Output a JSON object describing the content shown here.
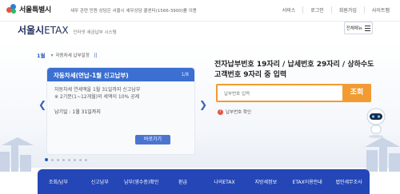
{
  "topbar": {
    "logo_text": "서울특별시",
    "notice": "세무 관련 민원 상담은 서울시 세무상담 콜센터(1566-3900)를 이용",
    "utility_links": [
      "서비스",
      "로그인",
      "회원가입",
      "사이트맵"
    ]
  },
  "header": {
    "brand_seoul": "서울시",
    "brand_etax": "ETAX",
    "brand_sub": "인터넷 세금납부 시스템",
    "menu_label": "전체메뉴"
  },
  "schedule": {
    "month": "1월",
    "category": "자동차세 납부일정",
    "control": "||",
    "card_title": "자동차세(연납-1월 신고납부)",
    "card_page": "1/8",
    "line1": "자동차세 연세액을 1월 31일까지 신고납부",
    "line2": "※ 2기분(1~12개월)의 세액이 10% 공제",
    "due": "납기일 : 1월 31일까지",
    "button_label": "바로가기"
  },
  "search": {
    "title": "전자납부번호 19자리 / 납세번호 29자리 / 상하수도고객번호 9자리 중 입력",
    "placeholder": "납부번호 입력",
    "button": "조회",
    "help_text": "납부번호 확인"
  },
  "bottom_nav": {
    "items": [
      "조회/납부",
      "신고납부",
      "납부(영수증)확인",
      "환급",
      "나의ETAX",
      "지방세정보",
      "ETAX이용안내",
      "법인세무조사"
    ]
  },
  "colors": {
    "accent_blue": "#2446b6",
    "card_blue": "#3b6fd1",
    "search_orange": "#f29b32"
  }
}
